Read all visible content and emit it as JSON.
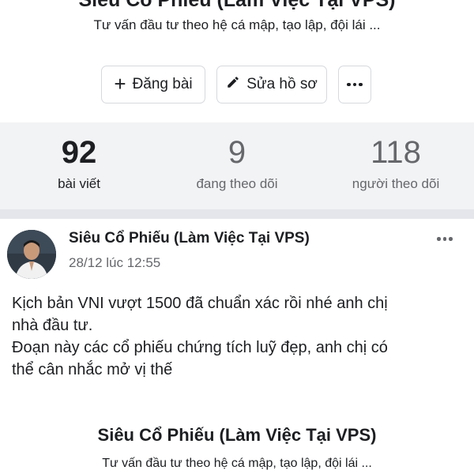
{
  "profile": {
    "name": "Siêu Cổ Phiếu (Làm Việc Tại VPS)",
    "bio": "Tư vấn đầu tư theo hệ cá mập, tạo lập, đội lái ..."
  },
  "actions": {
    "post_label": "Đăng bài",
    "edit_label": "Sửa hồ sơ"
  },
  "stats": [
    {
      "value": "92",
      "label": "bài viết"
    },
    {
      "value": "9",
      "label": "đang theo dõi"
    },
    {
      "value": "118",
      "label": "người theo dõi"
    }
  ],
  "post": {
    "author": "Siêu Cổ Phiếu (Làm Việc Tại VPS)",
    "date": "28/12 lúc 12:55",
    "lines": [
      "Kịch bản VNI vượt 1500 đã chuẩn xác rồi nhé anh chị",
      "nhà đầu tư.",
      "Đoạn này các cổ phiếu chứng tích luỹ đẹp, anh chị có",
      "thể cân nhắc mở vị thế"
    ]
  },
  "shared_card": {
    "title": "Siêu Cổ Phiếu (Làm Việc Tại VPS)",
    "subtitle": "Tư vấn đầu tư theo hệ cá mập, tạo lập, đội lái ..."
  },
  "icons": {
    "plus": "plus-icon",
    "edit": "pencil-icon",
    "more": "more-horizontal-icon"
  },
  "colors": {
    "stats_background": "#f2f3f5",
    "muted_text": "#65676b",
    "divider": "#e4e6eb"
  }
}
